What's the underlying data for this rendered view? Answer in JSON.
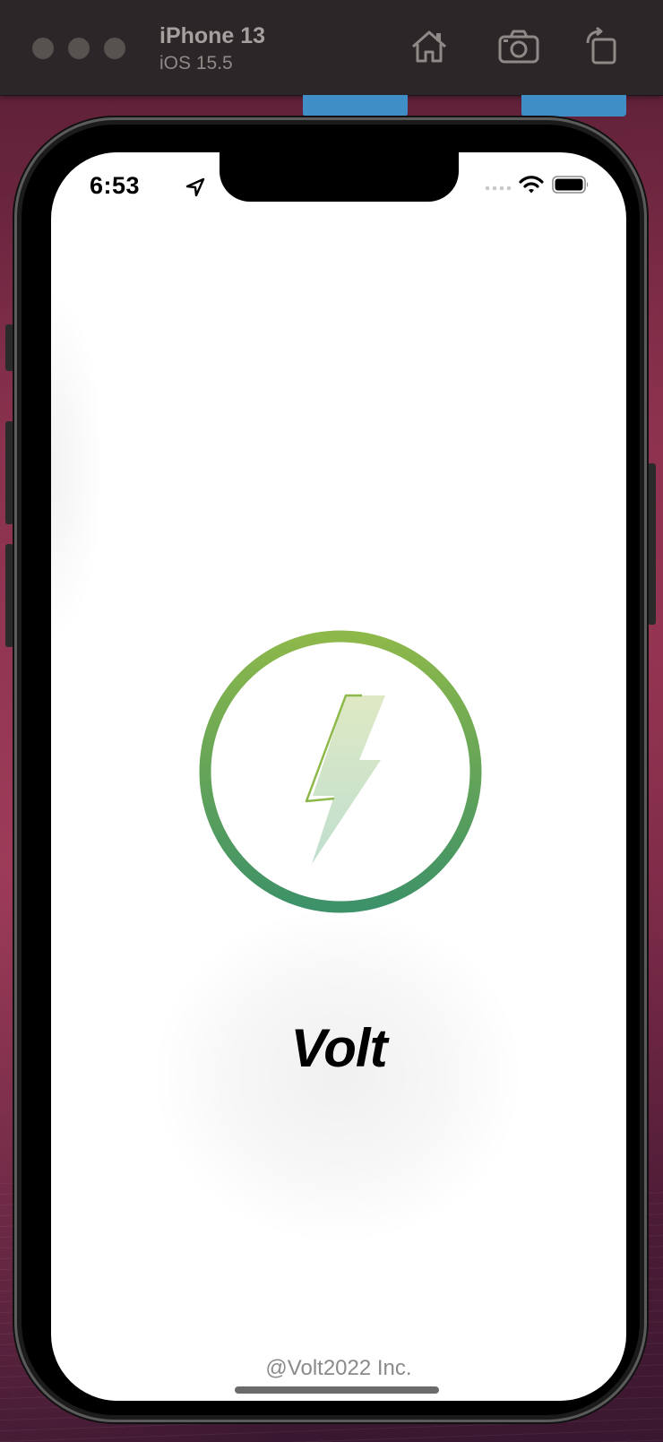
{
  "simulator": {
    "device_name": "iPhone 13",
    "os_version": "iOS 15.5",
    "toolbar_icons": [
      "home-icon",
      "screenshot-icon",
      "rotate-icon"
    ]
  },
  "status_bar": {
    "time": "6:53",
    "icons": [
      "location-arrow-icon",
      "signal-icon",
      "wifi-icon",
      "battery-icon"
    ]
  },
  "splash": {
    "app_name": "Volt",
    "copyright": "@Volt2022 Inc.",
    "logo_icon": "lightning-bolt-icon"
  },
  "colors": {
    "ring_top": "#8db84a",
    "ring_bottom": "#3d9168",
    "bolt_top": "#dfe9c4",
    "bolt_bottom": "#bfdfcf",
    "simulator_bar": "#2b2627"
  }
}
